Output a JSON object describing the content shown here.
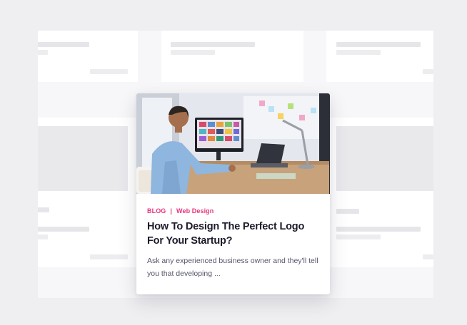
{
  "card": {
    "image_alt": "Man designing at a desk with monitor and laptop",
    "category_primary": "BLOG",
    "separator": "|",
    "category_secondary": "Web Design",
    "title": "How To Design The Perfect Logo For Your Startup?",
    "excerpt": "Ask any experienced business owner and they'll tell you that developing ...",
    "accent_color": "#e8337b"
  }
}
